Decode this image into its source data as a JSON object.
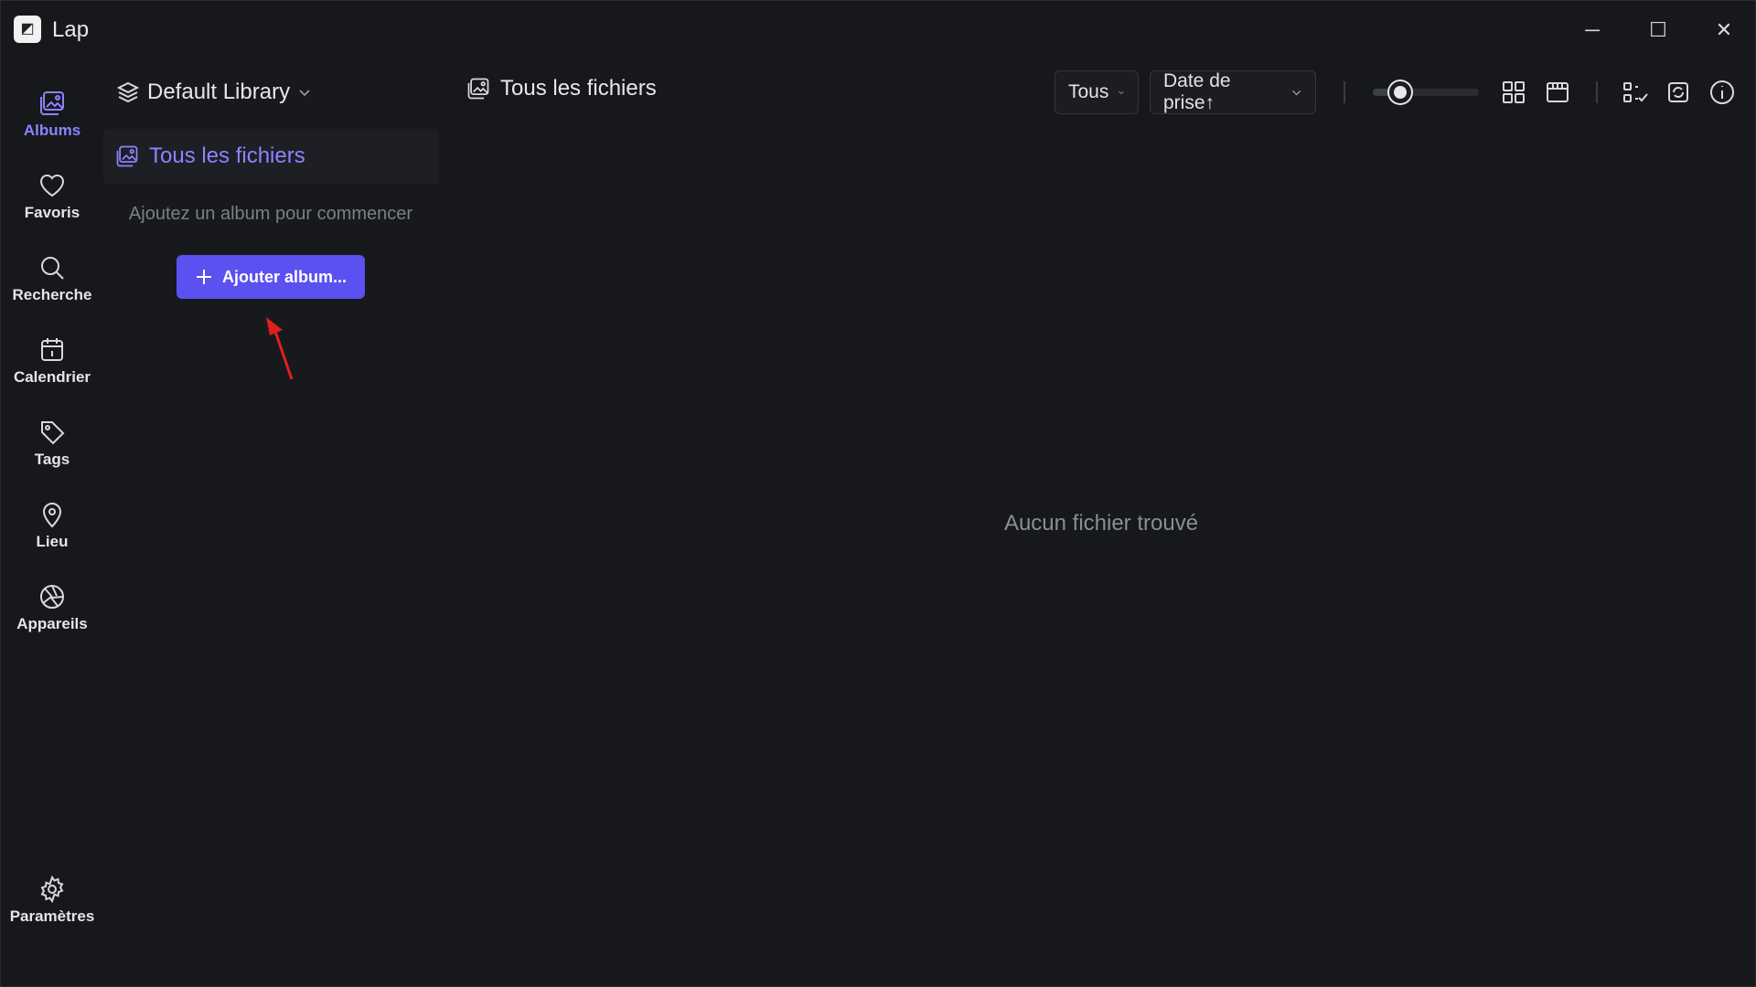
{
  "app": {
    "title": "Lap"
  },
  "window_controls": {
    "minimize": "─",
    "maximize": "☐",
    "close": "✕"
  },
  "rail": {
    "items": [
      {
        "label": "Albums",
        "icon": "albums-icon",
        "active": true
      },
      {
        "label": "Favoris",
        "icon": "heart-icon"
      },
      {
        "label": "Recherche",
        "icon": "search-icon"
      },
      {
        "label": "Calendrier",
        "icon": "calendar-icon"
      },
      {
        "label": "Tags",
        "icon": "tag-icon"
      },
      {
        "label": "Lieu",
        "icon": "location-pin-icon"
      },
      {
        "label": "Appareils",
        "icon": "camera-aperture-icon"
      }
    ],
    "settings": {
      "label": "Paramètres",
      "icon": "gear-icon"
    }
  },
  "album_pane": {
    "library_label": "Default Library",
    "all_files_label": "Tous les fichiers",
    "hint": "Ajoutez un album pour commencer",
    "add_button_label": "Ajouter album..."
  },
  "main": {
    "breadcrumb": "Tous les fichiers",
    "filter_dropdown": "Tous",
    "sort_dropdown": "Date de prise↑",
    "thumbnail_size_level": 0.2,
    "empty_message": "Aucun fichier trouvé"
  },
  "colors": {
    "accent": "#8b84ff",
    "button": "#5b50f0",
    "background": "#16181c",
    "annotation_arrow": "#e0201c"
  }
}
